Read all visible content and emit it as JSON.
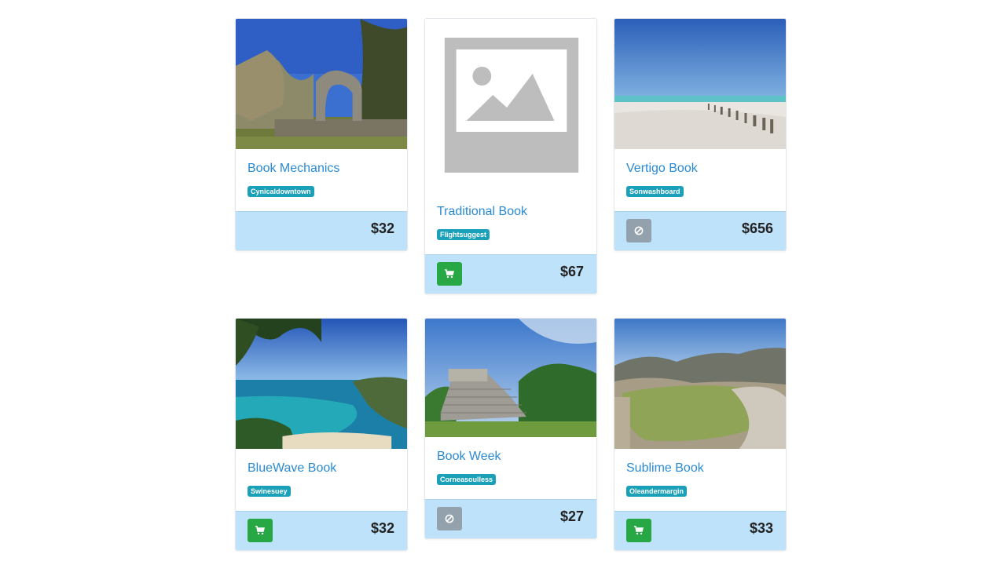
{
  "products": [
    {
      "title": "Book Mechanics",
      "badge": "Cynicaldowntown",
      "price": "$32",
      "image": "ruins-arch-photo",
      "action": "none"
    },
    {
      "title": "Traditional Book",
      "badge": "Flightsuggest",
      "price": "$67",
      "image": "placeholder-image-icon",
      "action": "cart-icon"
    },
    {
      "title": "Vertigo Book",
      "badge": "Sonwashboard",
      "price": "$656",
      "image": "white-beach-photo",
      "action": "unavailable-icon"
    },
    {
      "title": "BlueWave Book",
      "badge": "Swinesuey",
      "price": "$32",
      "image": "turquoise-bay-photo",
      "action": "cart-icon"
    },
    {
      "title": "Book Week",
      "badge": "Corneasoulless",
      "price": "$27",
      "image": "temple-pyramid-photo",
      "action": "unavailable-icon"
    },
    {
      "title": "Sublime Book",
      "badge": "Oleandermargin",
      "price": "$33",
      "image": "mountain-pools-photo",
      "action": "cart-icon"
    }
  ],
  "colors": {
    "title": "#2a8ad4",
    "badge": "#1aa0b8",
    "footer": "#bfe2fb",
    "cart_button": "#28a745",
    "disabled_button": "#93a1ac"
  }
}
